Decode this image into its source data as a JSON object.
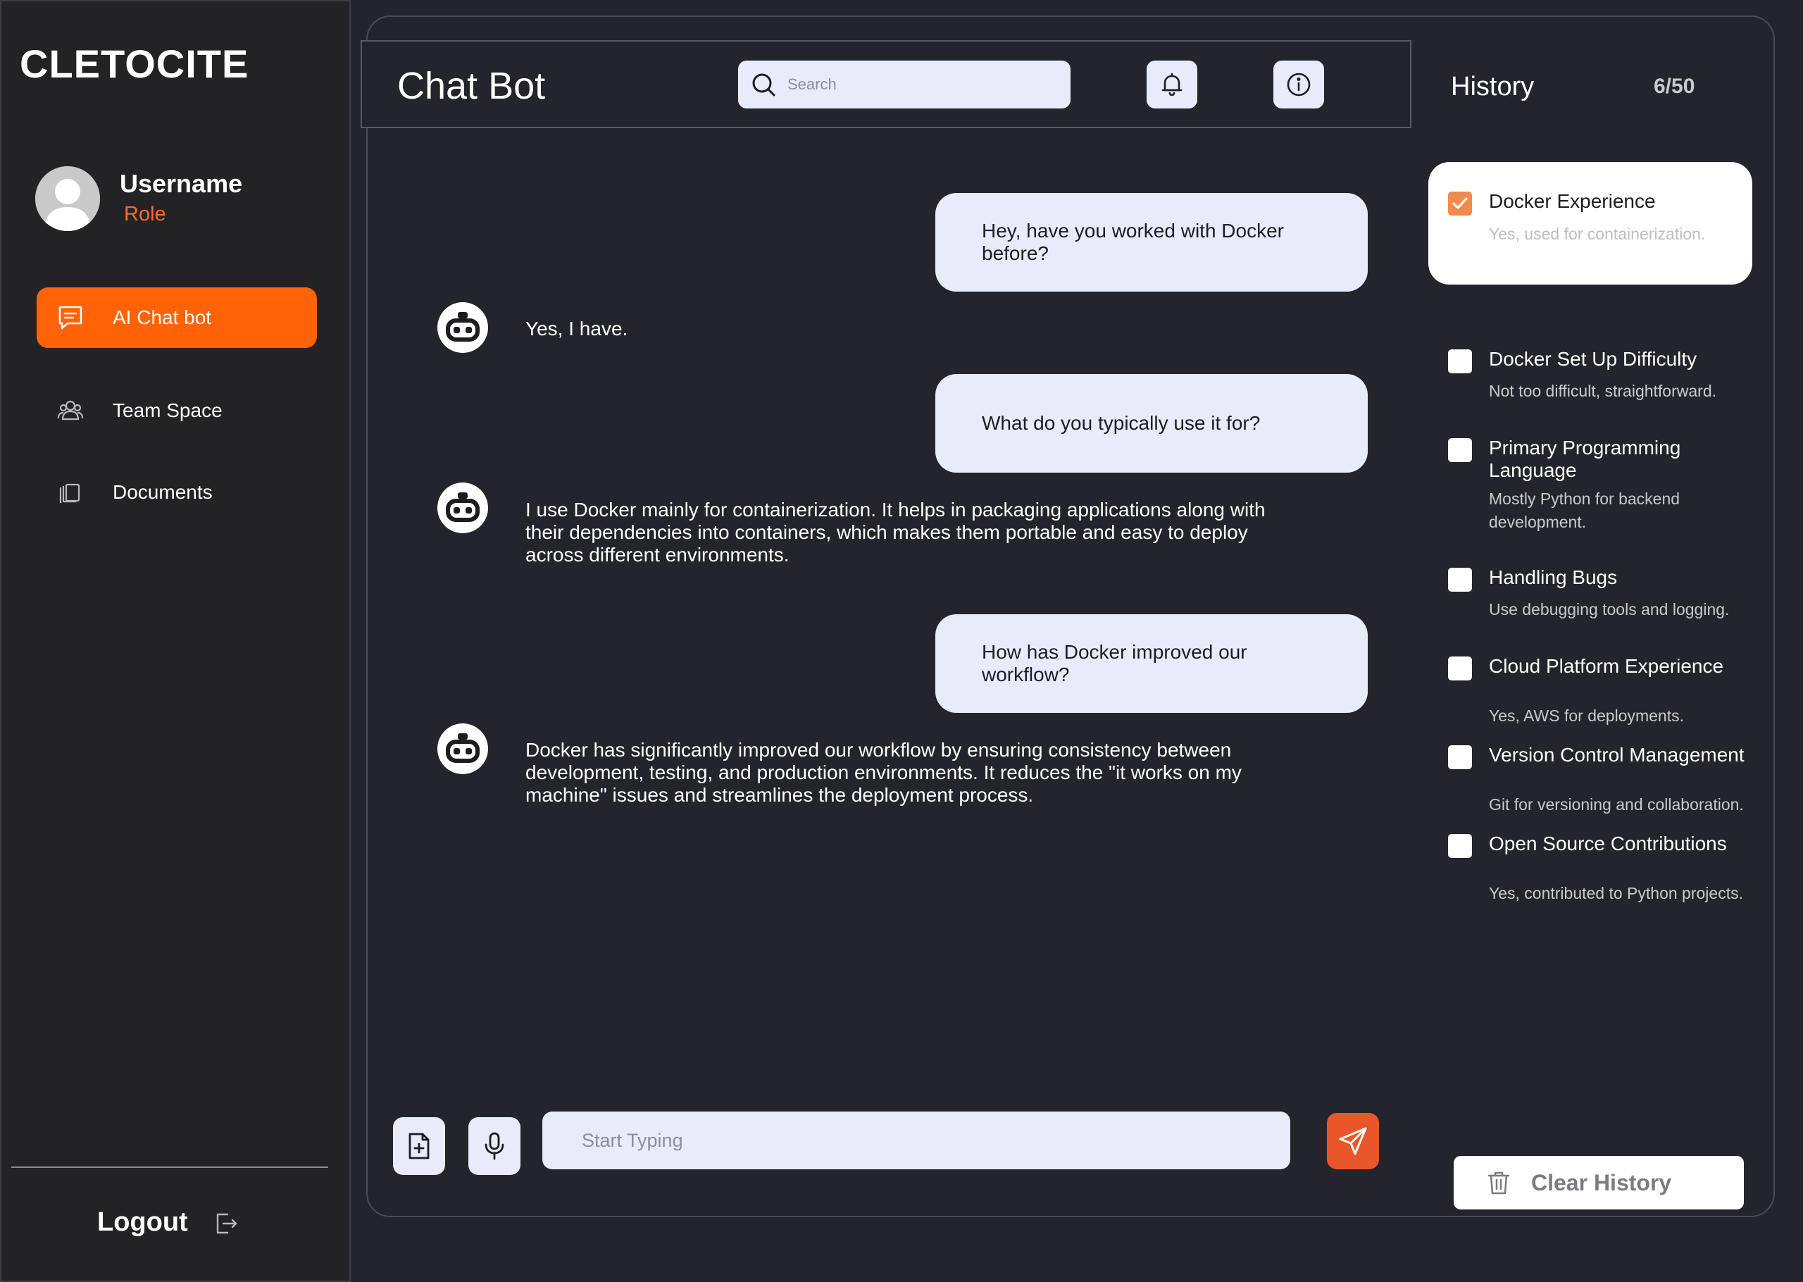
{
  "app": {
    "brand": "CLETOCITE"
  },
  "profile": {
    "username": "Username",
    "role": "Role"
  },
  "sidebar": {
    "items": [
      {
        "label": "AI Chat bot",
        "icon": "chat-icon",
        "active": true
      },
      {
        "label": "Team Space",
        "icon": "team-icon",
        "active": false
      },
      {
        "label": "Documents",
        "icon": "documents-icon",
        "active": false
      }
    ],
    "logout_label": "Logout"
  },
  "header": {
    "title": "Chat Bot",
    "search_placeholder": "Search"
  },
  "chat": {
    "messages": [
      {
        "sender": "user",
        "text": "Hey, have you worked with Docker before?"
      },
      {
        "sender": "bot",
        "text": "Yes, I have."
      },
      {
        "sender": "user",
        "text": "What do you typically use it for?"
      },
      {
        "sender": "bot",
        "text": "I use Docker mainly for containerization. It helps in packaging applications along with their dependencies into containers, which makes them portable and easy to deploy across different environments."
      },
      {
        "sender": "user",
        "text": "How has Docker improved our workflow?"
      },
      {
        "sender": "bot",
        "text": "Docker has significantly improved our workflow by ensuring consistency between development, testing, and production environments. It reduces the \"it works on my machine\" issues and streamlines the deployment process."
      }
    ],
    "composer_placeholder": "Start Typing"
  },
  "history": {
    "title": "History",
    "count": "6/50",
    "items": [
      {
        "title": "Docker Experience",
        "subtitle": "Yes, used for containerization.",
        "checked": true
      },
      {
        "title": "Docker Set Up Difficulty",
        "subtitle": "Not too difficult, straightforward.",
        "checked": false
      },
      {
        "title": "Primary Programming Language",
        "subtitle": "Mostly Python for backend development.",
        "checked": false
      },
      {
        "title": "Handling Bugs",
        "subtitle": "Use debugging tools and logging.",
        "checked": false
      },
      {
        "title": "Cloud Platform Experience",
        "subtitle": "Yes, AWS for deployments.",
        "checked": false
      },
      {
        "title": "Version Control Management",
        "subtitle": "Git for versioning and collaboration.",
        "checked": false
      },
      {
        "title": "Open Source Contributions",
        "subtitle": "Yes, contributed to Python projects.",
        "checked": false
      }
    ],
    "clear_label": "Clear History"
  },
  "colors": {
    "accent": "#ff6308",
    "send": "#e8572a",
    "role": "#ff6a2b",
    "checked": "#f28a4e",
    "background": "#24252c",
    "bubble": "#e8ebfa"
  }
}
